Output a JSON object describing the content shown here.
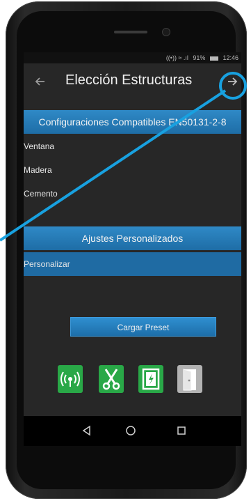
{
  "status_bar": {
    "signal": "((•)) ≈ .ıl",
    "battery": "91%",
    "time": "12:46"
  },
  "title_bar": {
    "title": "Elección Estructuras"
  },
  "sections": {
    "compatible": {
      "header": "Configuraciones Compatibles EN50131-2-8",
      "items": [
        "Ventana",
        "Madera",
        "Cemento"
      ]
    },
    "custom": {
      "header": "Ajustes Personalizados",
      "items": [
        "Personalizar"
      ]
    }
  },
  "buttons": {
    "preset_label": "Cargar Preset"
  },
  "sensor_icons": [
    "wireless-sensor-icon",
    "scissors-icon",
    "window-icon",
    "door-icon"
  ],
  "colors": {
    "accent_blue": "#1f6ba3",
    "highlight": "#18a1e0",
    "icon_green": "#29a847",
    "icon_gray": "#b3b3b3"
  }
}
